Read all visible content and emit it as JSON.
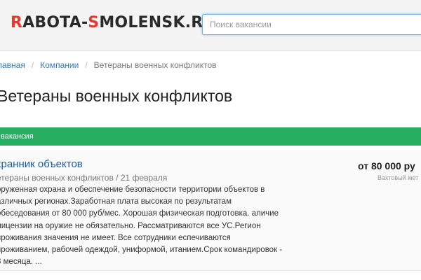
{
  "header": {
    "logo_part1": "R",
    "logo_part2": "ABOTA-",
    "logo_part3": "S",
    "logo_part4": "MOLENSK.RU",
    "search_placeholder": "Поиск вакансии",
    "accent_color": "#e23b2e"
  },
  "breadcrumb": {
    "items": [
      "лавная",
      "Компании",
      "Ветераны военных конфликтов"
    ]
  },
  "page": {
    "title": "Ветераны военных конфликтов"
  },
  "section": {
    "label": "вакансия",
    "color": "#27ae60"
  },
  "vacancy": {
    "title": "хранник объектов",
    "meta": "етераны военных конфликтов / 21 февраля",
    "salary": "от 80 000 ру",
    "type": "Вахтовый мет",
    "description": "оруженная охрана и обеспечение безопасности территории объектов в азличных регионах.Заработная плата высокая по результатам обеседования от 80 000 руб/мес. Хорошая физическая подготовка. аличие лицензии на оружие не обязательно. Рассматриваются все УС.Регион проживания значения не имеет. Все сотрудники еспечиваются проживанием, рабочей одеждой, униформой, итанием.Срок командировок - 3 месяца. ..."
  }
}
